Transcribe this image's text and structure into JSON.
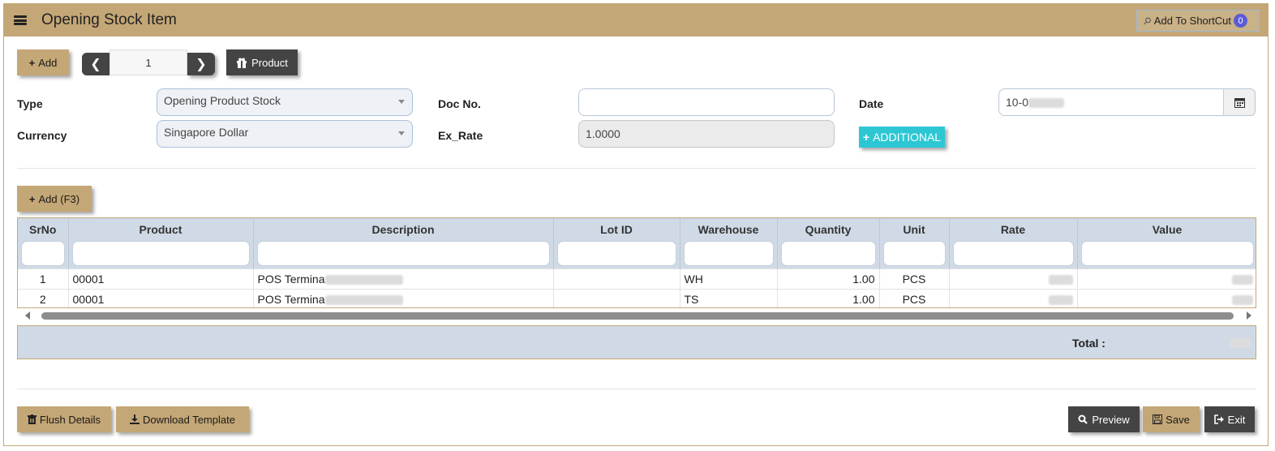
{
  "header": {
    "title": "Opening Stock Item",
    "shortcut_label": "Add To ShortCut",
    "shortcut_count": "0"
  },
  "toolbar": {
    "add_label": "Add",
    "page_number": "1",
    "product_label": "Product"
  },
  "form": {
    "type_label": "Type",
    "type_value": "Opening Product Stock",
    "docno_label": "Doc No.",
    "docno_value": "",
    "date_label": "Date",
    "date_value": "10-0",
    "currency_label": "Currency",
    "currency_value": "Singapore Dollar",
    "exrate_label": "Ex_Rate",
    "exrate_value": "1.0000",
    "additional_label": "ADDITIONAL"
  },
  "grid": {
    "add_label": "Add (F3)",
    "columns": [
      "SrNo",
      "Product",
      "Description",
      "Lot ID",
      "Warehouse",
      "Quantity",
      "Unit",
      "Rate",
      "Value"
    ],
    "rows": [
      {
        "srno": "1",
        "product": "00001",
        "description": "POS Termina",
        "lot": "",
        "warehouse": "WH",
        "quantity": "1.00",
        "unit": "PCS"
      },
      {
        "srno": "2",
        "product": "00001",
        "description": "POS Termina",
        "lot": "",
        "warehouse": "TS",
        "quantity": "1.00",
        "unit": "PCS"
      }
    ],
    "total_label": "Total :"
  },
  "footer": {
    "flush_label": "Flush Details",
    "download_label": "Download Template",
    "preview_label": "Preview",
    "save_label": "Save",
    "exit_label": "Exit"
  },
  "colors": {
    "accent": "#c4a776",
    "dark_button": "#444444",
    "teal": "#2dc7d4",
    "grid_header": "#cfdae6"
  }
}
